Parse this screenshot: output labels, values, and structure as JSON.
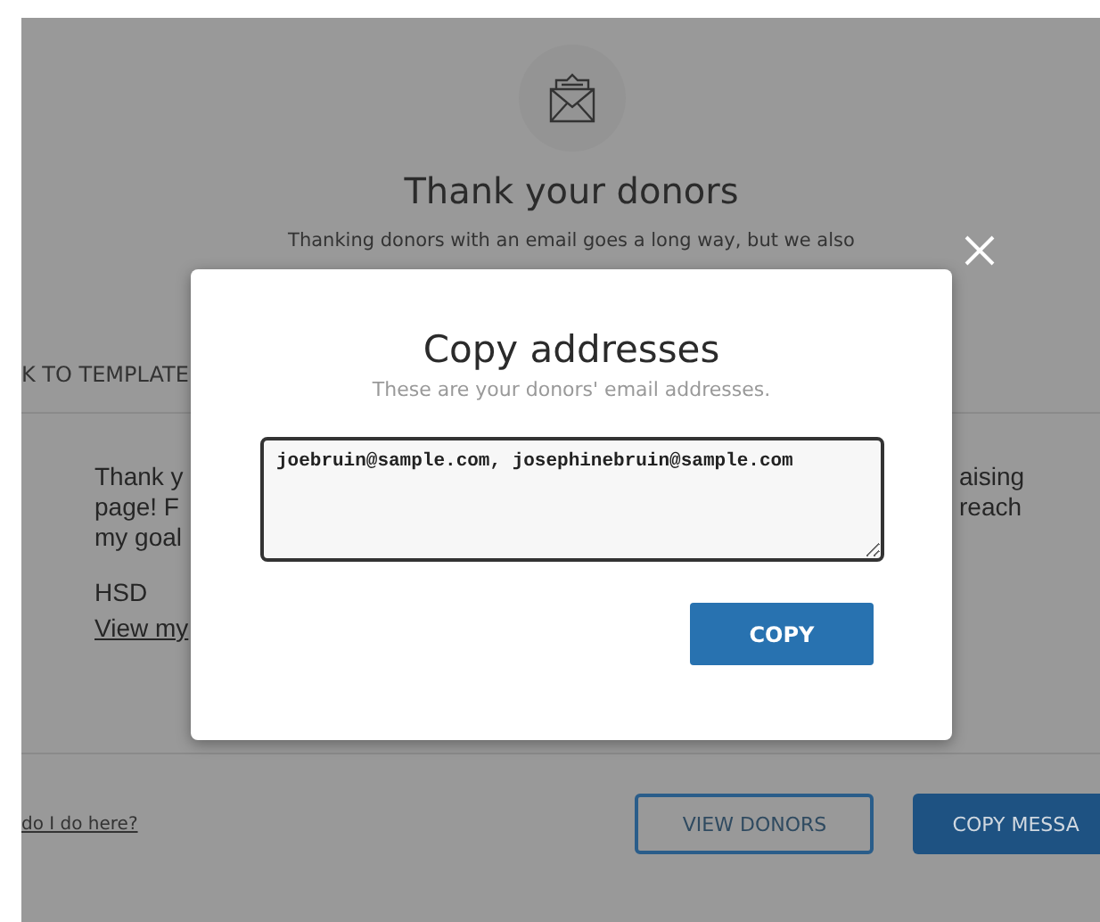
{
  "background_page": {
    "title": "Thank your donors",
    "description": "Thanking donors with an email goes a long way, but we also",
    "back_link": "K TO TEMPLATE",
    "message": {
      "left_lines": [
        "Thank y",
        "page! F",
        "my goal"
      ],
      "right_lines": [
        "aising",
        "reach"
      ],
      "signature": "HSD",
      "link": "View my"
    },
    "help_link": "do I do here?",
    "buttons": [
      "VIEW DONORS",
      "COPY MESSA"
    ]
  },
  "modal": {
    "title": "Copy addresses",
    "subtitle": "These are your donors' email addresses.",
    "addresses": "joebruin@sample.com, josephinebruin@sample.com",
    "button": "COPY"
  }
}
